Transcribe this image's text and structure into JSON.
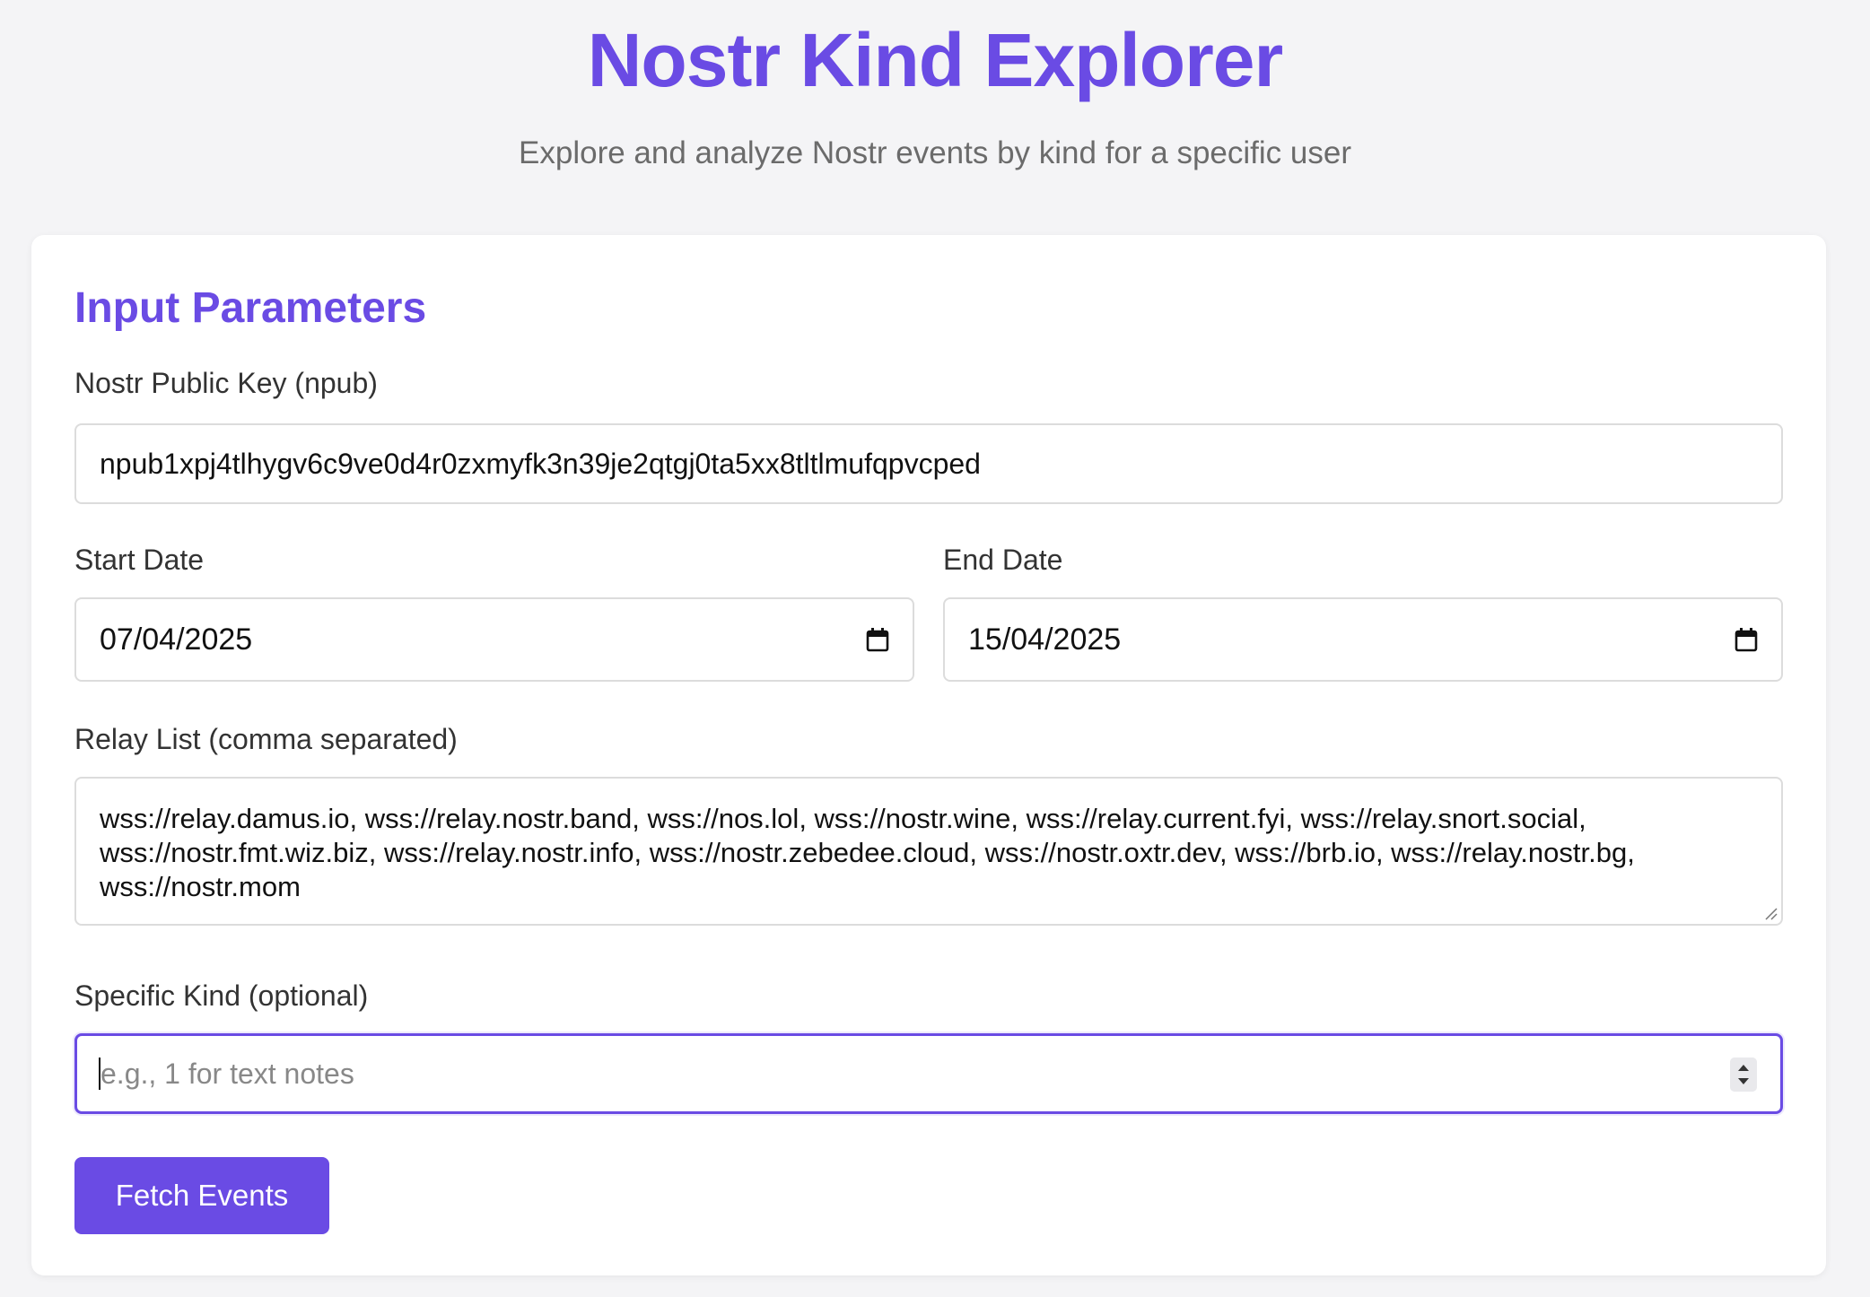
{
  "header": {
    "title": "Nostr Kind Explorer",
    "subtitle": "Explore and analyze Nostr events by kind for a specific user"
  },
  "form": {
    "section_title": "Input Parameters",
    "npub": {
      "label": "Nostr Public Key (npub)",
      "value": "npub1xpj4tlhygv6c9ve0d4r0zxmyfk3n39je2qtgj0ta5xx8tltlmufqpvcped"
    },
    "start_date": {
      "label": "Start Date",
      "value": "07/04/2025"
    },
    "end_date": {
      "label": "End Date",
      "value": "15/04/2025"
    },
    "relays": {
      "label": "Relay List (comma separated)",
      "value": "wss://relay.damus.io, wss://relay.nostr.band, wss://nos.lol, wss://nostr.wine, wss://relay.current.fyi, wss://relay.snort.social, wss://nostr.fmt.wiz.biz, wss://relay.nostr.info, wss://nostr.zebedee.cloud, wss://nostr.oxtr.dev, wss://brb.io, wss://relay.nostr.bg, wss://nostr.mom"
    },
    "kind": {
      "label": "Specific Kind (optional)",
      "value": "",
      "placeholder": "e.g., 1 for text notes"
    },
    "submit_label": "Fetch Events"
  },
  "colors": {
    "accent": "#6a4be4",
    "background": "#f4f4f6",
    "card": "#ffffff",
    "text": "#333333",
    "muted": "#6b6b6b"
  },
  "icons": {
    "date_picker": "calendar-icon",
    "number_stepper": "spinner-icon",
    "textarea_resize": "resize-handle-icon"
  }
}
